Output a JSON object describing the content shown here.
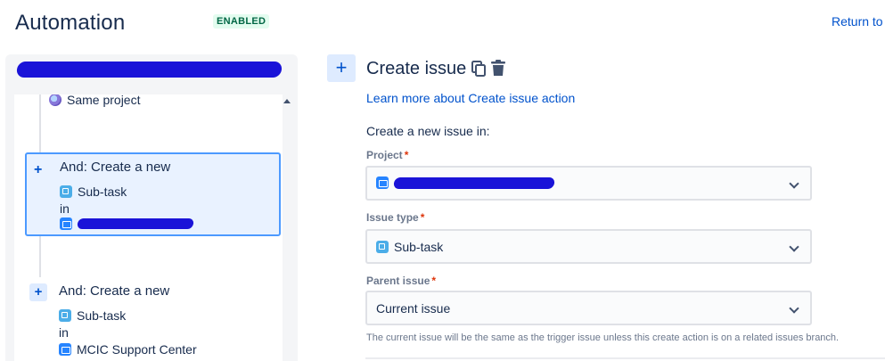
{
  "header": {
    "title": "Automation",
    "status": "ENABLED",
    "return_link": "Return to"
  },
  "rule_list": {
    "top_item_label": "Same project",
    "cards": [
      {
        "title": "And: Create a new",
        "issue_type": "Sub-task",
        "connector": "in",
        "project": ""
      },
      {
        "title": "And: Create a new",
        "issue_type": "Sub-task",
        "connector": "in",
        "project": "MCIC Support Center"
      }
    ]
  },
  "action_panel": {
    "add_label": "+",
    "title": "Create issue",
    "learn_link": "Learn more about Create issue action",
    "intro": "Create a new issue in:",
    "fields": {
      "project": {
        "label": "Project",
        "required_mark": "*",
        "value": ""
      },
      "issue_type": {
        "label": "Issue type",
        "required_mark": "*",
        "value": "Sub-task"
      },
      "parent_issue": {
        "label": "Parent issue",
        "required_mark": "*",
        "value": "Current issue"
      }
    },
    "helper": "The current issue will be the same as the trigger issue unless this create action is on a related issues branch."
  },
  "icons": {
    "copy": "copy-icon",
    "trash": "trash-icon",
    "subtask": "subtask-icon",
    "project": "project-icon",
    "globe": "globe-icon",
    "chevron": "chevron-down-icon"
  },
  "colors": {
    "accent": "#0052cc",
    "lozenge_bg": "#e3fcef",
    "lozenge_text": "#006644",
    "required": "#de350b"
  }
}
